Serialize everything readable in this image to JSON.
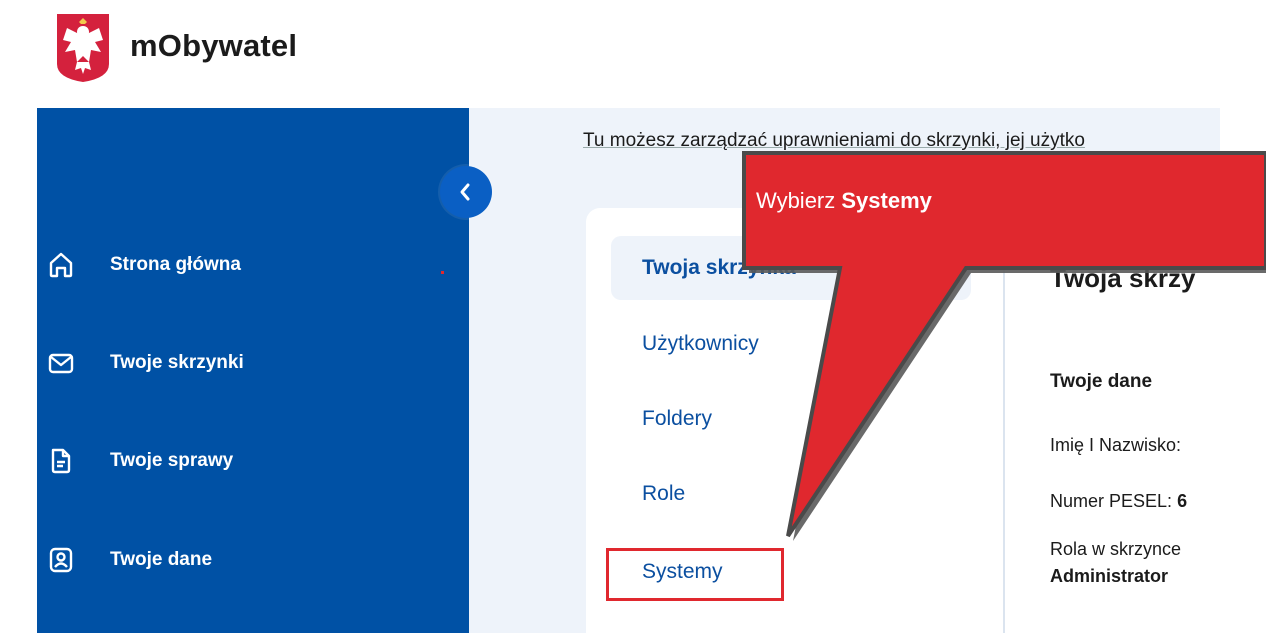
{
  "header": {
    "title": "mObywatel",
    "logo_icon": "polish-eagle-emblem-icon"
  },
  "sidebar": {
    "collapse_icon": "chevron-left-icon",
    "items": [
      {
        "label": "Strona główna",
        "icon": "home-icon"
      },
      {
        "label": "Twoje skrzynki",
        "icon": "envelope-icon"
      },
      {
        "label": "Twoje sprawy",
        "icon": "document-icon"
      },
      {
        "label": "Twoje dane",
        "icon": "user-card-icon"
      }
    ]
  },
  "main": {
    "intro_text": "Tu możesz zarządzać uprawnieniami do skrzynki, jej użytko",
    "menu": [
      {
        "label": "Twoja skrzynka",
        "active": true
      },
      {
        "label": "Użytkownicy",
        "active": false
      },
      {
        "label": "Foldery",
        "active": false
      },
      {
        "label": "Role",
        "active": false
      },
      {
        "label": "Systemy",
        "active": false
      }
    ],
    "panel": {
      "title": "Twoja skrzy",
      "section_title": "Twoje dane",
      "name_label": "Imię I Nazwisko:",
      "pesel_label": "Numer PESEL:",
      "pesel_value": "6",
      "role_label": "Rola w skrzynce",
      "role_value": "Administrator"
    }
  },
  "callout": {
    "prefix": "Wybierz ",
    "emphasis": "Systemy"
  },
  "colors": {
    "sidebar": "#0051a5",
    "accent": "#0b4fa0",
    "callout": "#e0282e",
    "content_bg": "#eef3fa"
  }
}
